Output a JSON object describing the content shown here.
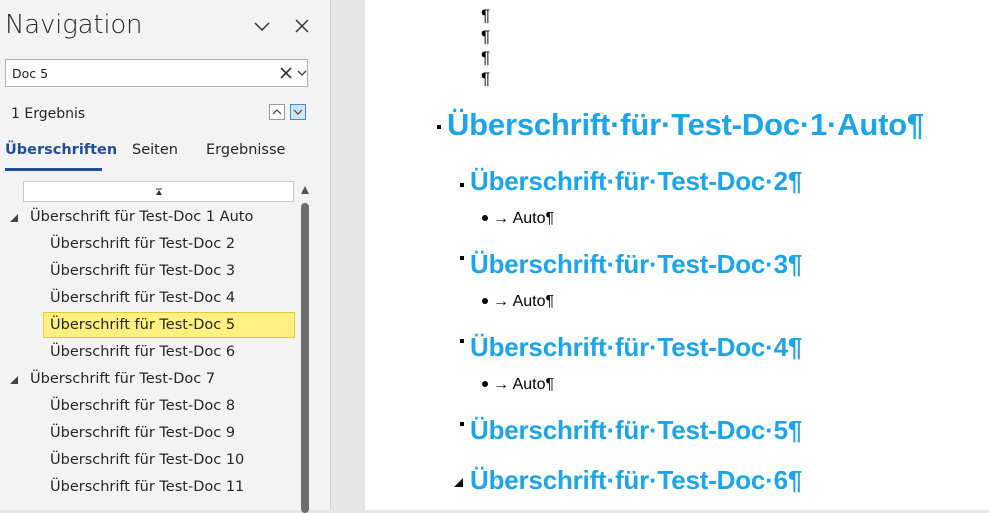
{
  "navigation": {
    "title": "Navigation",
    "search_value": "Doc 5",
    "result_count": "1 Ergebnis",
    "tabs": [
      {
        "label": "Überschriften"
      },
      {
        "label": "Seiten"
      },
      {
        "label": "Ergebnisse"
      }
    ],
    "active_tab": "Überschriften",
    "tree": [
      {
        "label": "Überschrift für Test-Doc 1 Auto"
      },
      {
        "label": "Überschrift für Test-Doc 2"
      },
      {
        "label": "Überschrift für Test-Doc 3"
      },
      {
        "label": "Überschrift für Test-Doc 4"
      },
      {
        "label": "Überschrift für Test-Doc 5"
      },
      {
        "label": "Überschrift für Test-Doc 6"
      },
      {
        "label": "Überschrift für Test-Doc 7"
      },
      {
        "label": "Überschrift für Test-Doc 8"
      },
      {
        "label": "Überschrift für Test-Doc 9"
      },
      {
        "label": "Überschrift für Test-Doc 10"
      },
      {
        "label": "Überschrift für Test-Doc 11"
      }
    ],
    "selected_item": "Überschrift für Test-Doc 5"
  },
  "document": {
    "pilcrow": "¶",
    "heading1": "Überschrift·für·Test-Doc·1·Auto¶",
    "headings": [
      {
        "text": "Überschrift·für·Test-Doc·2¶",
        "bullet": "→ Auto¶"
      },
      {
        "text": "Überschrift·für·Test-Doc·3¶",
        "bullet": "→ Auto¶"
      },
      {
        "text": "Überschrift·für·Test-Doc·4¶",
        "bullet": "→ Auto¶"
      },
      {
        "text": "Überschrift·für·Test-Doc·5¶"
      },
      {
        "text": "Überschrift·für·Test-Doc·6¶"
      }
    ]
  },
  "colors": {
    "heading": "#1ea4e9",
    "selection": "#fff080",
    "active_tab": "#1f4e9c"
  },
  "icons": {
    "collapse": "chevron-down-icon",
    "close": "close-icon",
    "clear": "clear-search-icon",
    "dropdown": "dropdown-icon",
    "previous": "previous-result-icon",
    "next": "next-result-icon",
    "expanded": "expanded-triangle-icon",
    "scroll_up": "scroll-up-icon"
  }
}
